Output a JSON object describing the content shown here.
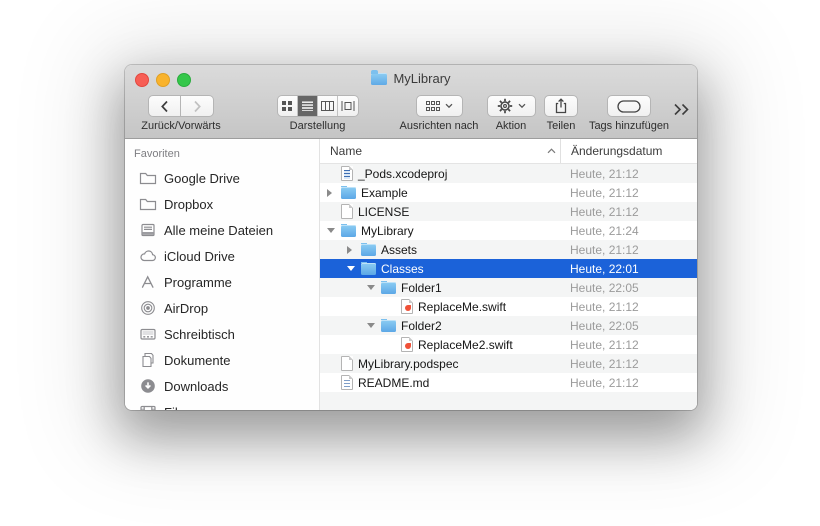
{
  "window": {
    "title": "MyLibrary",
    "title_icon": "folder-icon",
    "traffic_lights": [
      "close",
      "minimize",
      "zoom"
    ]
  },
  "toolbar": {
    "back_forward_label": "Zurück/Vorwärts",
    "view_label": "Darstellung",
    "view_modes": [
      "icons",
      "list",
      "columns",
      "coverflow"
    ],
    "view_selected": "list",
    "arrange_label": "Ausrichten nach",
    "action_label": "Aktion",
    "share_label": "Teilen",
    "tags_label": "Tags hinzufügen",
    "overflow_icon": "double-chevron-right"
  },
  "sidebar": {
    "section_title": "Favoriten",
    "items": [
      {
        "label": "Google Drive",
        "icon": "folder"
      },
      {
        "label": "Dropbox",
        "icon": "folder"
      },
      {
        "label": "Alle meine Dateien",
        "icon": "all-files"
      },
      {
        "label": "iCloud Drive",
        "icon": "cloud"
      },
      {
        "label": "Programme",
        "icon": "applications"
      },
      {
        "label": "AirDrop",
        "icon": "airdrop"
      },
      {
        "label": "Schreibtisch",
        "icon": "desktop"
      },
      {
        "label": "Dokumente",
        "icon": "documents"
      },
      {
        "label": "Downloads",
        "icon": "downloads"
      },
      {
        "label": "Filme",
        "icon": "movies"
      }
    ]
  },
  "list": {
    "columns": [
      {
        "label": "Name",
        "sort": "ascending"
      },
      {
        "label": "Änderungsdatum"
      }
    ],
    "rows": [
      {
        "name": "_Pods.xcodeproj",
        "date": "Heute, 21:12",
        "icon": "xcodeproj-file",
        "indent": 0,
        "disclosure": "none",
        "selected": false
      },
      {
        "name": "Example",
        "date": "Heute, 21:12",
        "icon": "folder",
        "indent": 0,
        "disclosure": "collapsed",
        "selected": false
      },
      {
        "name": "LICENSE",
        "date": "Heute, 21:12",
        "icon": "document",
        "indent": 0,
        "disclosure": "none",
        "selected": false
      },
      {
        "name": "MyLibrary",
        "date": "Heute, 21:24",
        "icon": "folder",
        "indent": 0,
        "disclosure": "expanded",
        "selected": false
      },
      {
        "name": "Assets",
        "date": "Heute, 21:12",
        "icon": "folder",
        "indent": 1,
        "disclosure": "collapsed",
        "selected": false
      },
      {
        "name": "Classes",
        "date": "Heute, 22:01",
        "icon": "folder",
        "indent": 1,
        "disclosure": "expanded",
        "selected": true
      },
      {
        "name": "Folder1",
        "date": "Heute, 22:05",
        "icon": "folder",
        "indent": 2,
        "disclosure": "expanded",
        "selected": false
      },
      {
        "name": "ReplaceMe.swift",
        "date": "Heute, 21:12",
        "icon": "swift-file",
        "indent": 3,
        "disclosure": "none",
        "selected": false
      },
      {
        "name": "Folder2",
        "date": "Heute, 22:05",
        "icon": "folder",
        "indent": 2,
        "disclosure": "expanded",
        "selected": false
      },
      {
        "name": "ReplaceMe2.swift",
        "date": "Heute, 21:12",
        "icon": "swift-file",
        "indent": 3,
        "disclosure": "none",
        "selected": false
      },
      {
        "name": "MyLibrary.podspec",
        "date": "Heute, 21:12",
        "icon": "document",
        "indent": 0,
        "disclosure": "none",
        "selected": false
      },
      {
        "name": "README.md",
        "date": "Heute, 21:12",
        "icon": "text-document",
        "indent": 0,
        "disclosure": "none",
        "selected": false
      }
    ]
  },
  "colors": {
    "selection_blue": "#1b62d9",
    "row_stripe": "#f4f5f5",
    "folder_blue": "#67b1e8",
    "chrome_top": "#dbdbdb",
    "chrome_bottom": "#c5c5c5",
    "traffic_red": "#f75e55",
    "traffic_yellow": "#f9b32c",
    "traffic_green": "#35c74a",
    "date_gray": "#9b9b9b"
  }
}
